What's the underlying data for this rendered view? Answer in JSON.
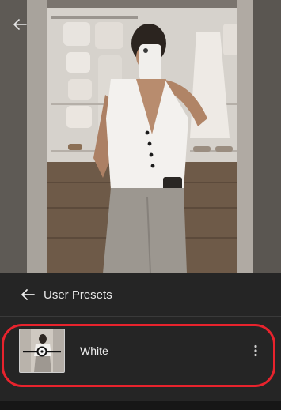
{
  "photo": {
    "description_icon": "photo-canvas",
    "back_icon": "arrow-left-icon"
  },
  "panel": {
    "back_icon": "arrow-left-icon",
    "title": "User Presets",
    "presets": [
      {
        "name": "White",
        "thumb_icon": "slider-thumbnail-icon",
        "menu_icon": "more-vertical-icon"
      }
    ]
  },
  "colors": {
    "panel_bg": "#262626",
    "text": "#e8e8e8",
    "highlight": "#e8232d"
  }
}
